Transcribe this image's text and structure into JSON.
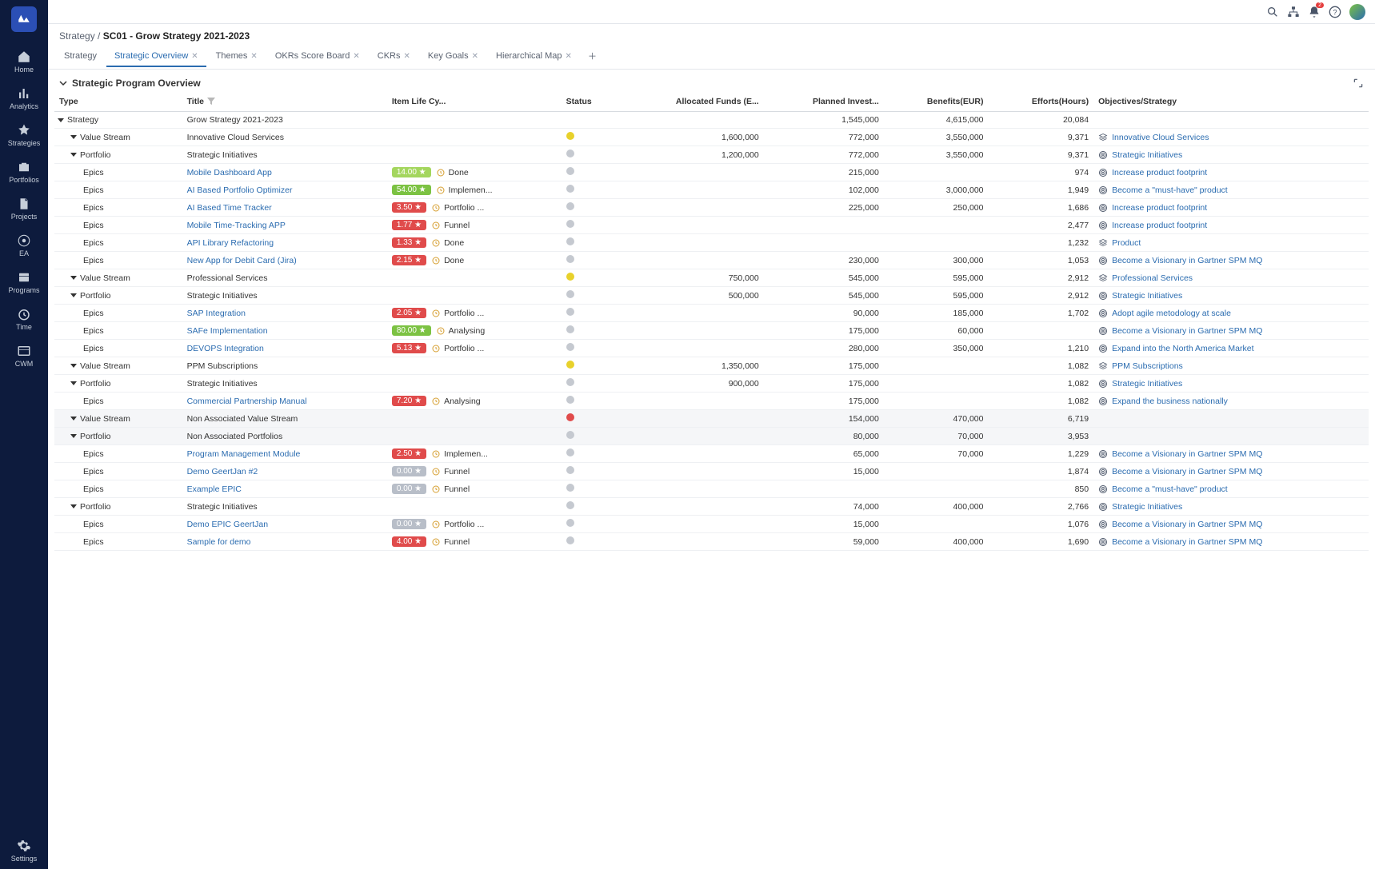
{
  "sidebar": {
    "items": [
      {
        "key": "home",
        "label": "Home"
      },
      {
        "key": "analytics",
        "label": "Analytics"
      },
      {
        "key": "strategies",
        "label": "Strategies"
      },
      {
        "key": "portfolios",
        "label": "Portfolios"
      },
      {
        "key": "projects",
        "label": "Projects"
      },
      {
        "key": "ea",
        "label": "EA"
      },
      {
        "key": "programs",
        "label": "Programs"
      },
      {
        "key": "time",
        "label": "Time"
      },
      {
        "key": "cwm",
        "label": "CWM"
      }
    ],
    "settings_label": "Settings"
  },
  "topbar": {
    "notification_count": "2"
  },
  "breadcrumb": {
    "parent": "Strategy",
    "sep": " / ",
    "current": "SC01 - Grow Strategy 2021-2023"
  },
  "tabs": [
    {
      "label": "Strategy",
      "closable": false,
      "active": false
    },
    {
      "label": "Strategic Overview",
      "closable": true,
      "active": true
    },
    {
      "label": "Themes",
      "closable": true,
      "active": false
    },
    {
      "label": "OKRs Score Board",
      "closable": true,
      "active": false
    },
    {
      "label": "CKRs",
      "closable": true,
      "active": false
    },
    {
      "label": "Key Goals",
      "closable": true,
      "active": false
    },
    {
      "label": "Hierarchical Map",
      "closable": true,
      "active": false
    }
  ],
  "panel_title": "Strategic Program Overview",
  "columns": [
    "Type",
    "Title",
    "Item Life Cy...",
    "Status",
    "Allocated Funds (E...",
    "Planned Invest...",
    "Benefits(EUR)",
    "Efforts(Hours)",
    "Objectives/Strategy"
  ],
  "rows": [
    {
      "indent": 0,
      "caret": true,
      "type": "Strategy",
      "title": "Grow Strategy 2021-2023",
      "link": false,
      "score": "",
      "score_color": "",
      "lifecycle": "",
      "status": "",
      "alloc": "",
      "planned": "1,545,000",
      "benefits": "4,615,000",
      "efforts": "20,084",
      "obj": "",
      "obj_icon": "",
      "dim": false
    },
    {
      "indent": 1,
      "caret": true,
      "type": "Value Stream",
      "title": "Innovative Cloud Services",
      "link": false,
      "score": "",
      "score_color": "",
      "lifecycle": "",
      "status": "yellow",
      "alloc": "1,600,000",
      "planned": "772,000",
      "benefits": "3,550,000",
      "efforts": "9,371",
      "obj": "Innovative Cloud Services",
      "obj_icon": "stack",
      "dim": false
    },
    {
      "indent": 1,
      "caret": true,
      "type": "Portfolio",
      "title": "Strategic Initiatives",
      "link": false,
      "score": "",
      "score_color": "",
      "lifecycle": "",
      "status": "gray",
      "alloc": "1,200,000",
      "planned": "772,000",
      "benefits": "3,550,000",
      "efforts": "9,371",
      "obj": "Strategic Initiatives",
      "obj_icon": "target",
      "dim": false
    },
    {
      "indent": 2,
      "caret": false,
      "type": "Epics",
      "title": "Mobile Dashboard App",
      "link": true,
      "score": "14.00 ★",
      "score_color": "lime",
      "lifecycle": "Done",
      "status": "gray",
      "alloc": "",
      "planned": "215,000",
      "benefits": "",
      "efforts": "974",
      "obj": "Increase product footprint",
      "obj_icon": "target",
      "dim": false
    },
    {
      "indent": 2,
      "caret": false,
      "type": "Epics",
      "title": "AI Based Portfolio Optimizer",
      "link": true,
      "score": "54.00 ★",
      "score_color": "green",
      "lifecycle": "Implemen...",
      "status": "gray",
      "alloc": "",
      "planned": "102,000",
      "benefits": "3,000,000",
      "efforts": "1,949",
      "obj": "Become a \"must-have\" product",
      "obj_icon": "target",
      "dim": false
    },
    {
      "indent": 2,
      "caret": false,
      "type": "Epics",
      "title": "AI Based Time Tracker",
      "link": true,
      "score": "3.50 ★",
      "score_color": "red",
      "lifecycle": "Portfolio ...",
      "status": "gray",
      "alloc": "",
      "planned": "225,000",
      "benefits": "250,000",
      "efforts": "1,686",
      "obj": "Increase product footprint",
      "obj_icon": "target",
      "dim": false
    },
    {
      "indent": 2,
      "caret": false,
      "type": "Epics",
      "title": "Mobile Time-Tracking APP",
      "link": true,
      "score": "1.77 ★",
      "score_color": "red",
      "lifecycle": "Funnel",
      "status": "gray",
      "alloc": "",
      "planned": "",
      "benefits": "",
      "efforts": "2,477",
      "obj": "Increase product footprint",
      "obj_icon": "target",
      "dim": false
    },
    {
      "indent": 2,
      "caret": false,
      "type": "Epics",
      "title": "API Library Refactoring",
      "link": true,
      "score": "1.33 ★",
      "score_color": "red",
      "lifecycle": "Done",
      "status": "gray",
      "alloc": "",
      "planned": "",
      "benefits": "",
      "efforts": "1,232",
      "obj": "Product",
      "obj_icon": "stack",
      "dim": false
    },
    {
      "indent": 2,
      "caret": false,
      "type": "Epics",
      "title": "New App for Debit Card (Jira)",
      "link": true,
      "score": "2.15 ★",
      "score_color": "red",
      "lifecycle": "Done",
      "status": "gray",
      "alloc": "",
      "planned": "230,000",
      "benefits": "300,000",
      "efforts": "1,053",
      "obj": "Become a Visionary in Gartner SPM MQ",
      "obj_icon": "target",
      "dim": false
    },
    {
      "indent": 1,
      "caret": true,
      "type": "Value Stream",
      "title": "Professional Services",
      "link": false,
      "score": "",
      "score_color": "",
      "lifecycle": "",
      "status": "yellow",
      "alloc": "750,000",
      "planned": "545,000",
      "benefits": "595,000",
      "efforts": "2,912",
      "obj": "Professional Services",
      "obj_icon": "stack",
      "dim": false
    },
    {
      "indent": 1,
      "caret": true,
      "type": "Portfolio",
      "title": "Strategic Initiatives",
      "link": false,
      "score": "",
      "score_color": "",
      "lifecycle": "",
      "status": "gray",
      "alloc": "500,000",
      "planned": "545,000",
      "benefits": "595,000",
      "efforts": "2,912",
      "obj": "Strategic Initiatives",
      "obj_icon": "target",
      "dim": false
    },
    {
      "indent": 2,
      "caret": false,
      "type": "Epics",
      "title": "SAP Integration",
      "link": true,
      "score": "2.05 ★",
      "score_color": "red",
      "lifecycle": "Portfolio ...",
      "status": "gray",
      "alloc": "",
      "planned": "90,000",
      "benefits": "185,000",
      "efforts": "1,702",
      "obj": "Adopt agile metodology at scale",
      "obj_icon": "target",
      "dim": false
    },
    {
      "indent": 2,
      "caret": false,
      "type": "Epics",
      "title": "SAFe Implementation",
      "link": true,
      "score": "80.00 ★",
      "score_color": "green",
      "lifecycle": "Analysing",
      "status": "gray",
      "alloc": "",
      "planned": "175,000",
      "benefits": "60,000",
      "efforts": "",
      "obj": "Become a Visionary in Gartner SPM MQ",
      "obj_icon": "target",
      "dim": false
    },
    {
      "indent": 2,
      "caret": false,
      "type": "Epics",
      "title": "DEVOPS Integration",
      "link": true,
      "score": "5.13 ★",
      "score_color": "red",
      "lifecycle": "Portfolio ...",
      "status": "gray",
      "alloc": "",
      "planned": "280,000",
      "benefits": "350,000",
      "efforts": "1,210",
      "obj": "Expand into the North America Market",
      "obj_icon": "target",
      "dim": false
    },
    {
      "indent": 1,
      "caret": true,
      "type": "Value Stream",
      "title": "PPM Subscriptions",
      "link": false,
      "score": "",
      "score_color": "",
      "lifecycle": "",
      "status": "yellow",
      "alloc": "1,350,000",
      "planned": "175,000",
      "benefits": "",
      "efforts": "1,082",
      "obj": "PPM Subscriptions",
      "obj_icon": "stack",
      "dim": false
    },
    {
      "indent": 1,
      "caret": true,
      "type": "Portfolio",
      "title": "Strategic Initiatives",
      "link": false,
      "score": "",
      "score_color": "",
      "lifecycle": "",
      "status": "gray",
      "alloc": "900,000",
      "planned": "175,000",
      "benefits": "",
      "efforts": "1,082",
      "obj": "Strategic Initiatives",
      "obj_icon": "target",
      "dim": false
    },
    {
      "indent": 2,
      "caret": false,
      "type": "Epics",
      "title": "Commercial Partnership Manual",
      "link": true,
      "score": "7.20 ★",
      "score_color": "red",
      "lifecycle": "Analysing",
      "status": "gray",
      "alloc": "",
      "planned": "175,000",
      "benefits": "",
      "efforts": "1,082",
      "obj": "Expand the business nationally",
      "obj_icon": "target",
      "dim": false
    },
    {
      "indent": 1,
      "caret": true,
      "type": "Value Stream",
      "title": "Non Associated Value Stream",
      "link": false,
      "score": "",
      "score_color": "",
      "lifecycle": "",
      "status": "red",
      "alloc": "",
      "planned": "154,000",
      "benefits": "470,000",
      "efforts": "6,719",
      "obj": "",
      "obj_icon": "",
      "dim": true
    },
    {
      "indent": 1,
      "caret": true,
      "type": "Portfolio",
      "title": "Non Associated Portfolios",
      "link": false,
      "score": "",
      "score_color": "",
      "lifecycle": "",
      "status": "gray",
      "alloc": "",
      "planned": "80,000",
      "benefits": "70,000",
      "efforts": "3,953",
      "obj": "",
      "obj_icon": "",
      "dim": true
    },
    {
      "indent": 2,
      "caret": false,
      "type": "Epics",
      "title": "Program Management Module",
      "link": true,
      "score": "2.50 ★",
      "score_color": "red",
      "lifecycle": "Implemen...",
      "status": "gray",
      "alloc": "",
      "planned": "65,000",
      "benefits": "70,000",
      "efforts": "1,229",
      "obj": "Become a Visionary in Gartner SPM MQ",
      "obj_icon": "target",
      "dim": false
    },
    {
      "indent": 2,
      "caret": false,
      "type": "Epics",
      "title": "Demo GeertJan #2",
      "link": true,
      "score": "0.00 ★",
      "score_color": "gray",
      "lifecycle": "Funnel",
      "status": "gray",
      "alloc": "",
      "planned": "15,000",
      "benefits": "",
      "efforts": "1,874",
      "obj": "Become a Visionary in Gartner SPM MQ",
      "obj_icon": "target",
      "dim": false
    },
    {
      "indent": 2,
      "caret": false,
      "type": "Epics",
      "title": "Example EPIC",
      "link": true,
      "score": "0.00 ★",
      "score_color": "gray",
      "lifecycle": "Funnel",
      "status": "gray",
      "alloc": "",
      "planned": "",
      "benefits": "",
      "efforts": "850",
      "obj": "Become a \"must-have\" product",
      "obj_icon": "target",
      "dim": false
    },
    {
      "indent": 1,
      "caret": true,
      "type": "Portfolio",
      "title": "Strategic Initiatives",
      "link": false,
      "score": "",
      "score_color": "",
      "lifecycle": "",
      "status": "gray",
      "alloc": "",
      "planned": "74,000",
      "benefits": "400,000",
      "efforts": "2,766",
      "obj": "Strategic Initiatives",
      "obj_icon": "target",
      "dim": false
    },
    {
      "indent": 2,
      "caret": false,
      "type": "Epics",
      "title": "Demo EPIC GeertJan",
      "link": true,
      "score": "0.00 ★",
      "score_color": "gray",
      "lifecycle": "Portfolio ...",
      "status": "gray",
      "alloc": "",
      "planned": "15,000",
      "benefits": "",
      "efforts": "1,076",
      "obj": "Become a Visionary in Gartner SPM MQ",
      "obj_icon": "target",
      "dim": false
    },
    {
      "indent": 2,
      "caret": false,
      "type": "Epics",
      "title": "Sample for demo",
      "link": true,
      "score": "4.00 ★",
      "score_color": "red",
      "lifecycle": "Funnel",
      "status": "gray",
      "alloc": "",
      "planned": "59,000",
      "benefits": "400,000",
      "efforts": "1,690",
      "obj": "Become a Visionary in Gartner SPM MQ",
      "obj_icon": "target",
      "dim": false
    }
  ]
}
